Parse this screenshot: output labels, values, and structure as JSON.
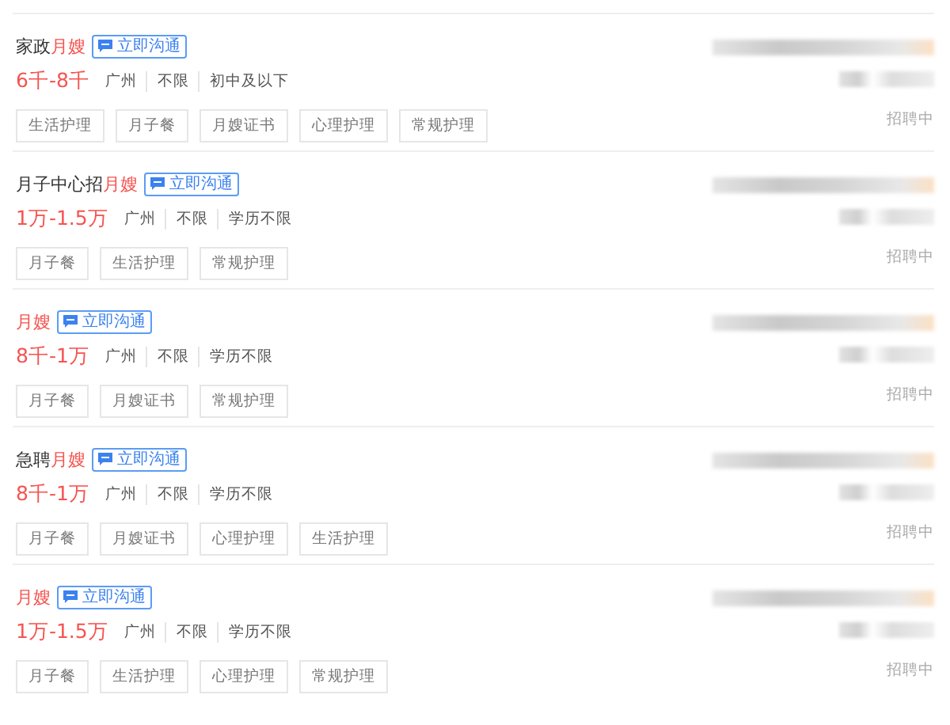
{
  "jobs": [
    {
      "title_prefix": "家政",
      "title_keyword": "月嫂",
      "chat_button": "立即沟通",
      "salary": "6千-8千",
      "meta": [
        "广州",
        "不限",
        "初中及以下"
      ],
      "tags": [
        "生活护理",
        "月子餐",
        "月嫂证书",
        "心理护理",
        "常规护理"
      ],
      "status": "招聘中"
    },
    {
      "title_prefix": "月子中心招",
      "title_keyword": "月嫂",
      "chat_button": "立即沟通",
      "salary": "1万-1.5万",
      "meta": [
        "广州",
        "不限",
        "学历不限"
      ],
      "tags": [
        "月子餐",
        "生活护理",
        "常规护理"
      ],
      "status": "招聘中"
    },
    {
      "title_keyword": "月嫂",
      "chat_button": "立即沟通",
      "salary": "8千-1万",
      "meta": [
        "广州",
        "不限",
        "学历不限"
      ],
      "tags": [
        "月子餐",
        "月嫂证书",
        "常规护理"
      ],
      "status": "招聘中"
    },
    {
      "title_prefix": "急聘",
      "title_keyword": "月嫂",
      "chat_button": "立即沟通",
      "salary": "8千-1万",
      "meta": [
        "广州",
        "不限",
        "学历不限"
      ],
      "tags": [
        "月子餐",
        "月嫂证书",
        "心理护理",
        "生活护理"
      ],
      "status": "招聘中"
    },
    {
      "title_keyword": "月嫂",
      "chat_button": "立即沟通",
      "salary": "1万-1.5万",
      "meta": [
        "广州",
        "不限",
        "学历不限"
      ],
      "tags": [
        "月子餐",
        "生活护理",
        "心理护理",
        "常规护理"
      ],
      "status": "招聘中"
    }
  ]
}
